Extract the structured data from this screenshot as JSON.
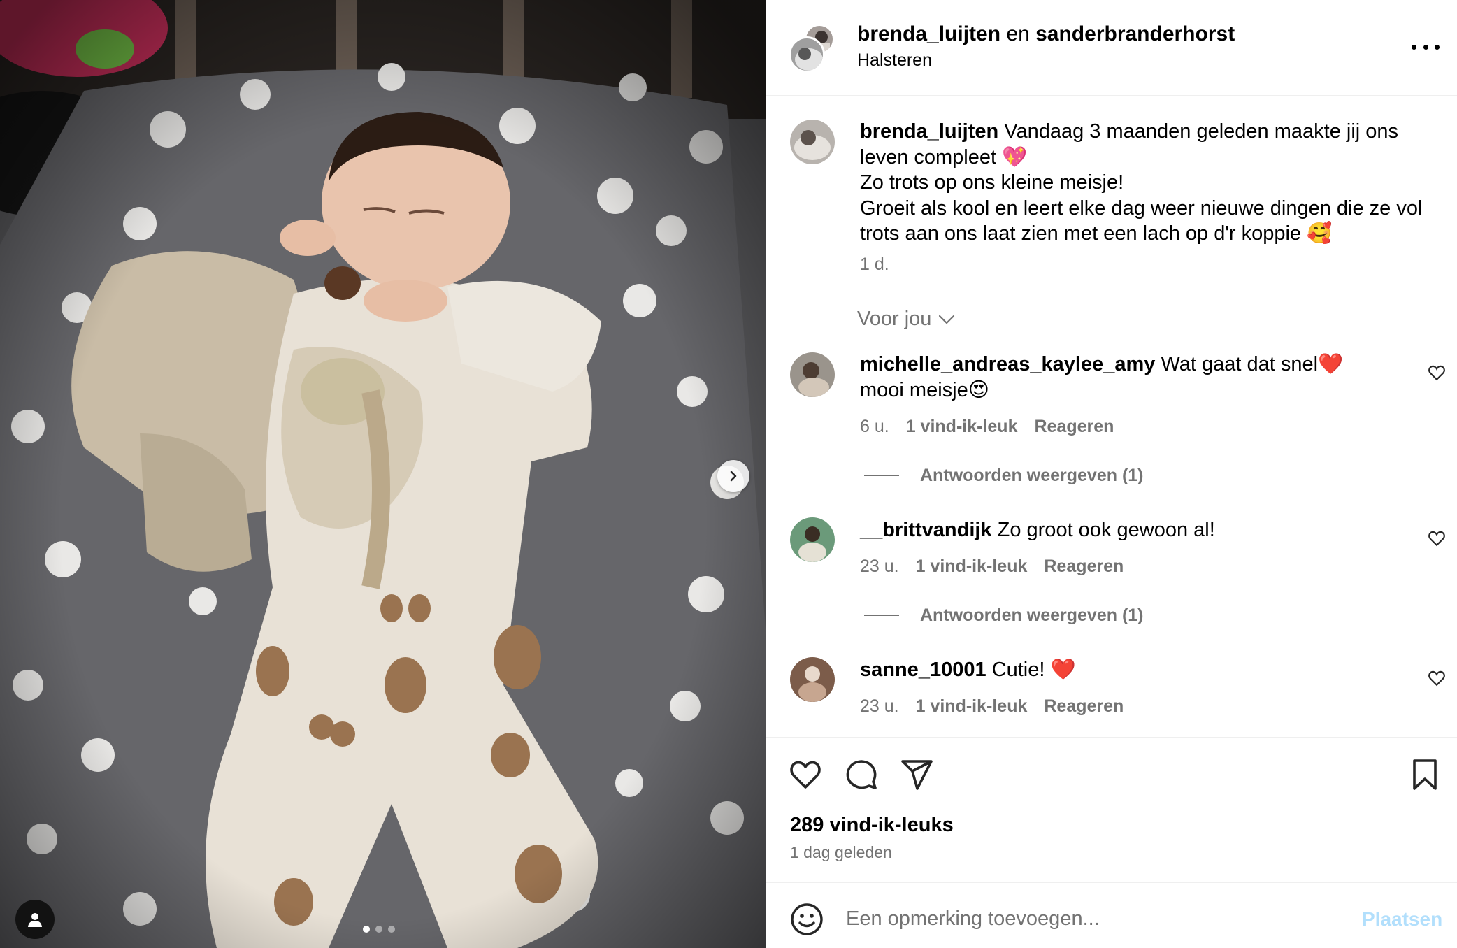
{
  "header": {
    "user1": "brenda_luijten",
    "joiner": "en",
    "user2": "sanderbranderhorst",
    "location": "Halsteren"
  },
  "caption": {
    "username": "brenda_luijten",
    "line1": "Vandaag 3 maanden geleden maakte jij ons leven compleet 💖",
    "line2": "Zo trots op ons kleine meisje!",
    "line3": "Groeit als kool en leert elke dag weer nieuwe dingen die ze vol trots aan ons laat zien met een lach op d'r koppie 🥰",
    "time": "1 d."
  },
  "filter": {
    "label": "Voor jou"
  },
  "comments": [
    {
      "username": "michelle_andreas_kaylee_amy",
      "text": "Wat gaat dat snel❤️ mooi meisje😍",
      "time": "6 u.",
      "likes": "1 vind-ik-leuk",
      "reply": "Reageren",
      "replies": "Antwoorden weergeven (1)"
    },
    {
      "username": "__brittvandijk",
      "text": "Zo groot ook gewoon al!",
      "time": "23 u.",
      "likes": "1 vind-ik-leuk",
      "reply": "Reageren",
      "replies": "Antwoorden weergeven (1)"
    },
    {
      "username": "sanne_10001",
      "text": "Cutie! ❤️",
      "time": "23 u.",
      "likes": "1 vind-ik-leuk",
      "reply": "Reageren"
    }
  ],
  "footer": {
    "likes": "289 vind-ik-leuks",
    "ago": "1 dag geleden",
    "placeholder": "Een opmerking toevoegen...",
    "post": "Plaatsen"
  },
  "carousel": {
    "current": 1,
    "total": 3
  },
  "icons": [
    "more-options-icon",
    "chevron-down-icon",
    "heart-icon",
    "comment-icon",
    "share-icon",
    "bookmark-icon",
    "emoji-icon",
    "chevron-right-icon",
    "user-tag-icon"
  ],
  "colors": {
    "muted": "#737373",
    "post_disabled": "#b2dffc",
    "heart_red": "#ed4956"
  }
}
